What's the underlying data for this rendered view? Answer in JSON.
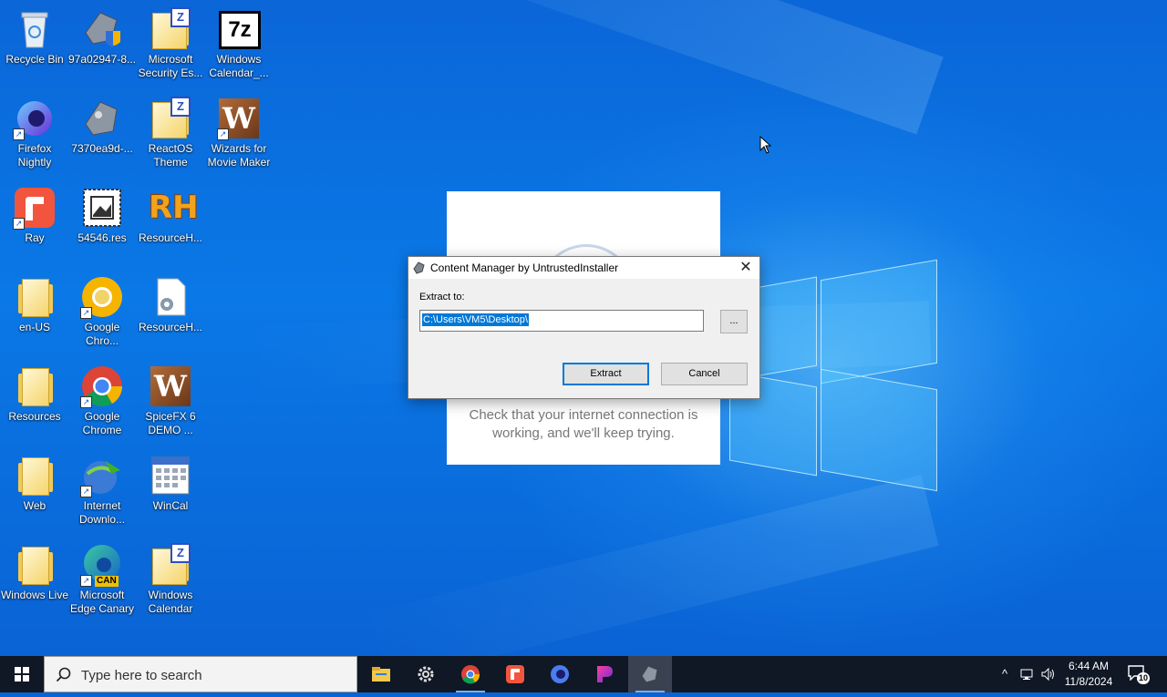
{
  "desktop": {
    "icons": [
      {
        "label": "Recycle Bin"
      },
      {
        "label": "97a02947-8..."
      },
      {
        "label": "Microsoft Security Es..."
      },
      {
        "label": "Windows Calendar_..."
      },
      {
        "label": "Firefox Nightly"
      },
      {
        "label": "7370ea9d-..."
      },
      {
        "label": "ReactOS Theme"
      },
      {
        "label": "Wizards for Movie Maker"
      },
      {
        "label": "Ray"
      },
      {
        "label": "54546.res"
      },
      {
        "label": "ResourceH..."
      },
      {
        "label": "en-US"
      },
      {
        "label": "Google Chro..."
      },
      {
        "label": "ResourceH..."
      },
      {
        "label": "Resources"
      },
      {
        "label": "Google Chrome"
      },
      {
        "label": "SpiceFX 6 DEMO ..."
      },
      {
        "label": "Web"
      },
      {
        "label": "Internet Downlo..."
      },
      {
        "label": "WinCal"
      },
      {
        "label": "Windows Live"
      },
      {
        "label": "Microsoft Edge Canary"
      },
      {
        "label": "Windows Calendar"
      }
    ],
    "edge_badge": "CAN",
    "sevenzip_text": "7z",
    "rh_text": "RH",
    "w_text": "W",
    "z_text": "Z"
  },
  "background_window": {
    "message": "Check that your internet connection is working, and we'll keep trying."
  },
  "dialog": {
    "title": "Content Manager by UntrustedInstaller",
    "close_glyph": "✕",
    "extract_label": "Extract to:",
    "path_value": "C:\\Users\\VM5\\Desktop\\",
    "browse_label": "...",
    "extract_button": "Extract",
    "cancel_button": "Cancel"
  },
  "taskbar": {
    "search_placeholder": "Type here to search",
    "apps": [
      "file-explorer",
      "settings",
      "google-chrome",
      "ray",
      "firefox-nightly",
      "paint-app",
      "content-manager"
    ],
    "clock_time": "6:44 AM",
    "clock_date": "11/8/2024",
    "notification_count": "10",
    "tray_chevron": "^"
  },
  "colors": {
    "accent": "#0078d7",
    "taskbar": "#101725",
    "desktop": "#0a63d4"
  }
}
